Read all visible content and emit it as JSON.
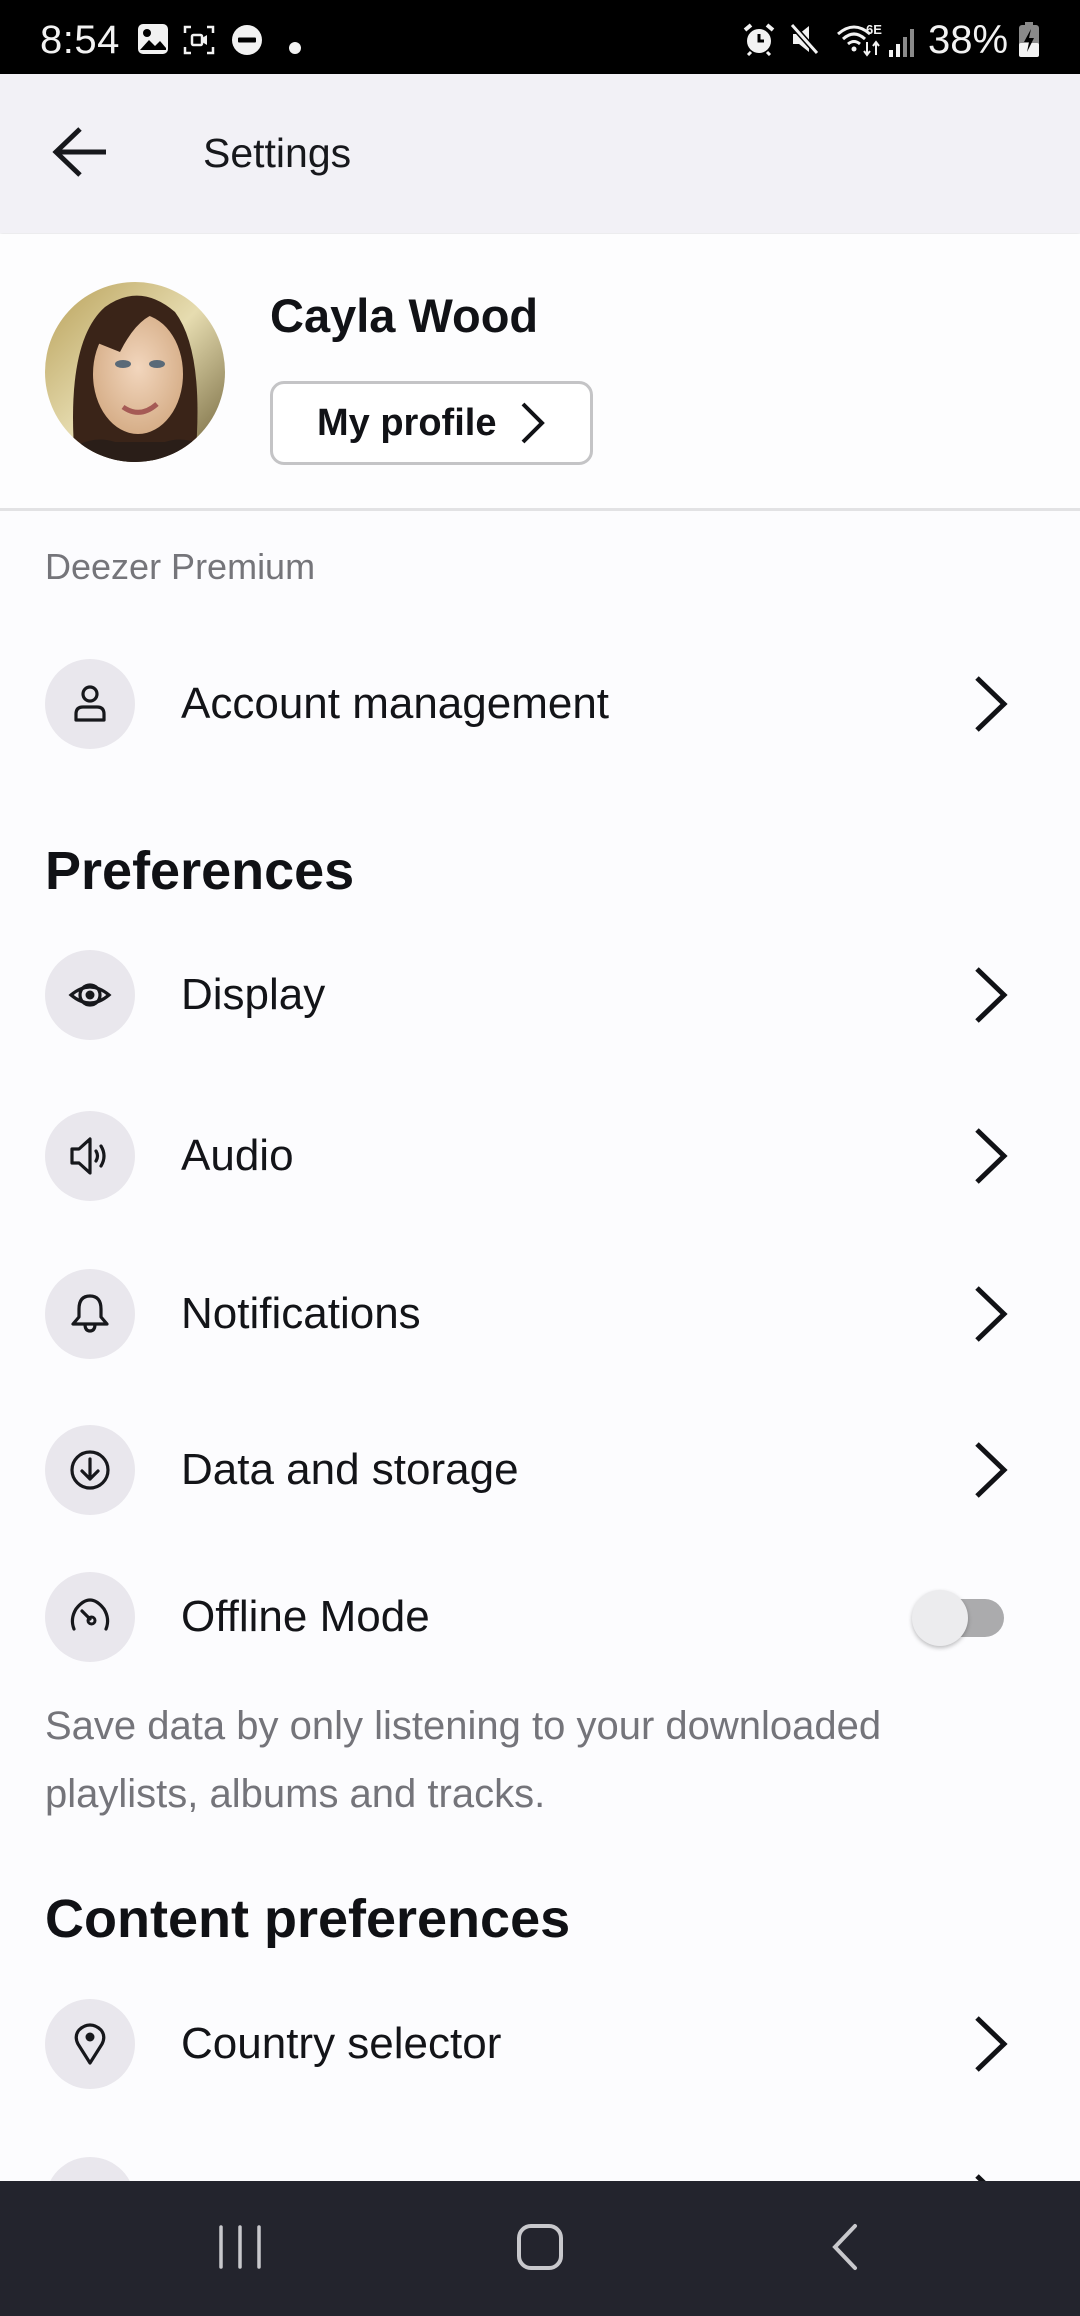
{
  "status_bar": {
    "time": "8:54",
    "left_icons": [
      "gallery-icon",
      "screen-record-icon",
      "do-not-disturb-icon",
      "dot-icon"
    ],
    "right_icons": [
      "alarm-icon",
      "mute-icon",
      "wifi-6e-icon",
      "signal-icon",
      "battery-charging-icon"
    ],
    "battery": "38%"
  },
  "header": {
    "back_icon": "arrow-left-icon",
    "title": "Settings"
  },
  "profile": {
    "name": "Cayla Wood",
    "button_label": "My profile"
  },
  "subscription": {
    "label": "Deezer Premium",
    "items": [
      {
        "label": "Account management",
        "icon": "user-icon"
      }
    ]
  },
  "preferences": {
    "heading": "Preferences",
    "items": [
      {
        "label": "Display",
        "icon": "eye-icon"
      },
      {
        "label": "Audio",
        "icon": "speaker-icon"
      },
      {
        "label": "Notifications",
        "icon": "bell-icon"
      },
      {
        "label": "Data and storage",
        "icon": "download-icon"
      },
      {
        "label": "Offline Mode",
        "icon": "gauge-icon",
        "toggle": false
      }
    ],
    "offline_description": "Save data by only listening to your downloaded playlists, albums and tracks."
  },
  "content_preferences": {
    "heading": "Content preferences",
    "items": [
      {
        "label": "Country selector",
        "icon": "location-pin-icon"
      }
    ]
  },
  "nav_bar": {
    "buttons": [
      "recents-icon",
      "home-icon",
      "back-icon"
    ]
  },
  "colors": {
    "header_bg": "#f2f1f6",
    "page_bg": "#fcfcfe",
    "icon_circle_bg": "#e9e7ed",
    "muted_text": "#75757a",
    "nav_bar_bg": "#23242d"
  }
}
